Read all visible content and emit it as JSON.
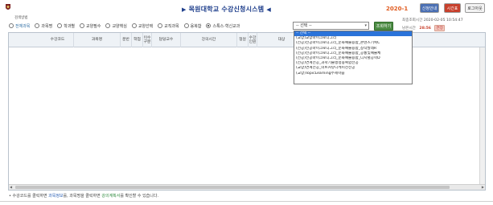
{
  "header": {
    "title": "목원대학교 수강신청시스템",
    "term": "2020-1",
    "buttons": {
      "info": "신청안내",
      "timetable": "시간표",
      "logout": "로그아웃"
    }
  },
  "search": {
    "label": "검색방법",
    "radios": [
      {
        "label": "전체과목",
        "checked": false
      },
      {
        "label": "과목명",
        "checked": false
      },
      {
        "label": "학과별",
        "checked": false
      },
      {
        "label": "교양필수",
        "checked": false
      },
      {
        "label": "교양핵심",
        "checked": false
      },
      {
        "label": "교양선택",
        "checked": false
      },
      {
        "label": "교직과목",
        "checked": false
      },
      {
        "label": "융복합",
        "checked": false
      },
      {
        "label": "스톡스·혁신교과",
        "checked": true
      }
    ],
    "select_value": "-- 선택 --",
    "query_button": "조회하기"
  },
  "session": {
    "inquiry_label": "최종조회시간",
    "inquiry_time": "2020-02-05 10:54:47",
    "remain_label": "남은시간",
    "remain_time": "28:56",
    "extend_button": "연장"
  },
  "table": {
    "headers": [
      "수강코드",
      "과목명",
      "분반",
      "학점",
      "이수구분",
      "담당교수",
      "강의시간",
      "정원",
      "수강인원",
      "대상"
    ]
  },
  "dropdown": {
    "options": [
      "-- 선택 --",
      "(교양)교양마이크로디그리",
      "(전공)전공마이크로디그리_문화예술융합_콘텐츠기획C",
      "(전공)전공마이크로디그리_문화예술융합_창작발레R",
      "(전공)전공마이크로디그리_문화예술융합_공통및예술체",
      "(전공)전공마이크로디그리_문화예술융합_디지털공학D",
      "(전공)연계전공_과학기술행정융복합전공",
      "(교양)연계전공_미트커뮤니케이션전공",
      "(교양)TopicLearning주제학습"
    ],
    "selected_index": 0
  },
  "footer": {
    "part1": "• 수강코드를 클릭하면 ",
    "link1": "과목정보",
    "part2": "를, 과목명을 클릭하면 ",
    "link2": "강의계획서",
    "part3": "를 확인할 수 있습니다."
  }
}
